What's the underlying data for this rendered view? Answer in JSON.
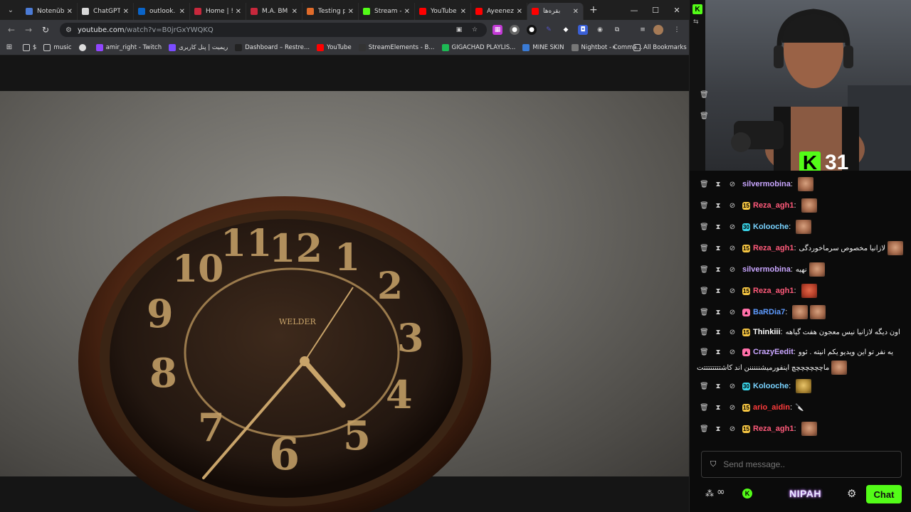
{
  "tabs": [
    {
      "label": "Notenüb",
      "color": "#4b7bd6"
    },
    {
      "label": "ChatGPT",
      "color": "#d8d8d8"
    },
    {
      "label": "outlook.",
      "color": "#0a64c8"
    },
    {
      "label": "Home | !",
      "color": "#c8283c"
    },
    {
      "label": "M.A. BM",
      "color": "#c8283c"
    },
    {
      "label": "Testing p",
      "color": "#e06b2a"
    },
    {
      "label": "Stream -",
      "color": "#53fc18"
    },
    {
      "label": "YouTube",
      "color": "#ff0000"
    },
    {
      "label": "Ayeenez",
      "color": "#ff0000"
    },
    {
      "label": "بقره‌ها",
      "color": "#ff0000",
      "active": true
    }
  ],
  "address": {
    "domain": "youtube.com",
    "path": "/watch?v=B0jrGxYWQKQ"
  },
  "bookmarks": [
    {
      "label": "$",
      "icon": "folder-icon"
    },
    {
      "label": "music",
      "icon": "folder-icon"
    },
    {
      "label": "",
      "icon": "globe-icon"
    },
    {
      "label": "amir_right - Twitch",
      "icon": "twitch-icon"
    },
    {
      "label": "ریمیت | پنل کاربری",
      "icon": "remit-icon"
    },
    {
      "label": "Dashboard – Restre...",
      "icon": "restream-icon"
    },
    {
      "label": "YouTube",
      "icon": "youtube-icon"
    },
    {
      "label": "StreamElements - B...",
      "icon": "streamelements-icon"
    },
    {
      "label": "GIGACHAD PLAYLIS...",
      "icon": "spotify-icon"
    },
    {
      "label": "MINE SKIN",
      "icon": "mineskin-icon"
    },
    {
      "label": "Nightbot - Comma...",
      "icon": "nightbot-icon"
    }
  ],
  "all_bookmarks_label": "All Bookmarks",
  "clock": {
    "brand": "WELDER"
  },
  "counter": {
    "logo": "K",
    "value": "31"
  },
  "chat": [
    {
      "user": "silvermobina",
      "color": "#c9a6ff",
      "badge": "",
      "message": "",
      "emotes": [
        "face"
      ]
    },
    {
      "user": "Reza_agh1",
      "color": "#ff5a7a",
      "badge": "15",
      "badge_color": "#f5c542",
      "message": "",
      "emotes": [
        "face"
      ]
    },
    {
      "user": "Kolooche",
      "color": "#7ad3ff",
      "badge": "30",
      "badge_color": "#3ad4e8",
      "message": "",
      "emotes": [
        "face"
      ]
    },
    {
      "user": "Reza_agh1",
      "color": "#ff5a7a",
      "badge": "15",
      "badge_color": "#f5c542",
      "message": "لازانیا مخصوص سرماخوردگی",
      "emotes": [
        "face"
      ]
    },
    {
      "user": "silvermobina",
      "color": "#c9a6ff",
      "badge": "",
      "message": "نهیه",
      "emotes": [
        "face"
      ]
    },
    {
      "user": "Reza_agh1",
      "color": "#ff5a7a",
      "badge": "15",
      "badge_color": "#f5c542",
      "message": "",
      "emotes": [
        "red"
      ]
    },
    {
      "user": "BaRDia7",
      "color": "#5e9bff",
      "badge": "▲",
      "badge_color": "#ff6fa8",
      "message": "",
      "emotes": [
        "face",
        "face"
      ]
    },
    {
      "user": "Thinkiii",
      "color": "#ffffff",
      "badge": "15",
      "badge_color": "#f5c542",
      "message": "اون دیگه لازانیا نیس معجون هفت گیاهه",
      "emotes": []
    },
    {
      "user": "CrazyEedit",
      "color": "#c9a6ff",
      "badge": "▲",
      "badge_color": "#ff6fa8",
      "message": "یه نفر تو این ویدیو یکم انیته . ئوو",
      "message2": "ماچچچچچچچ اینفورمیشنننننن اند کاشتتتتتتتتت",
      "emotes": [
        "face"
      ]
    },
    {
      "user": "Kolooche",
      "color": "#7ad3ff",
      "badge": "30",
      "badge_color": "#3ad4e8",
      "message": "",
      "emotes": [
        "gold"
      ]
    },
    {
      "user": "ario_aidin",
      "color": "#ff3c3c",
      "badge": "15",
      "badge_color": "#f5c542",
      "message": "🔪",
      "emotes": []
    },
    {
      "user": "Reza_agh1",
      "color": "#ff5a7a",
      "badge": "15",
      "badge_color": "#f5c542",
      "message": "",
      "emotes": [
        "face"
      ]
    }
  ],
  "send": {
    "placeholder": "Send message.."
  },
  "bottom": {
    "nipah": "NIPAH",
    "chat_label": "Chat"
  }
}
